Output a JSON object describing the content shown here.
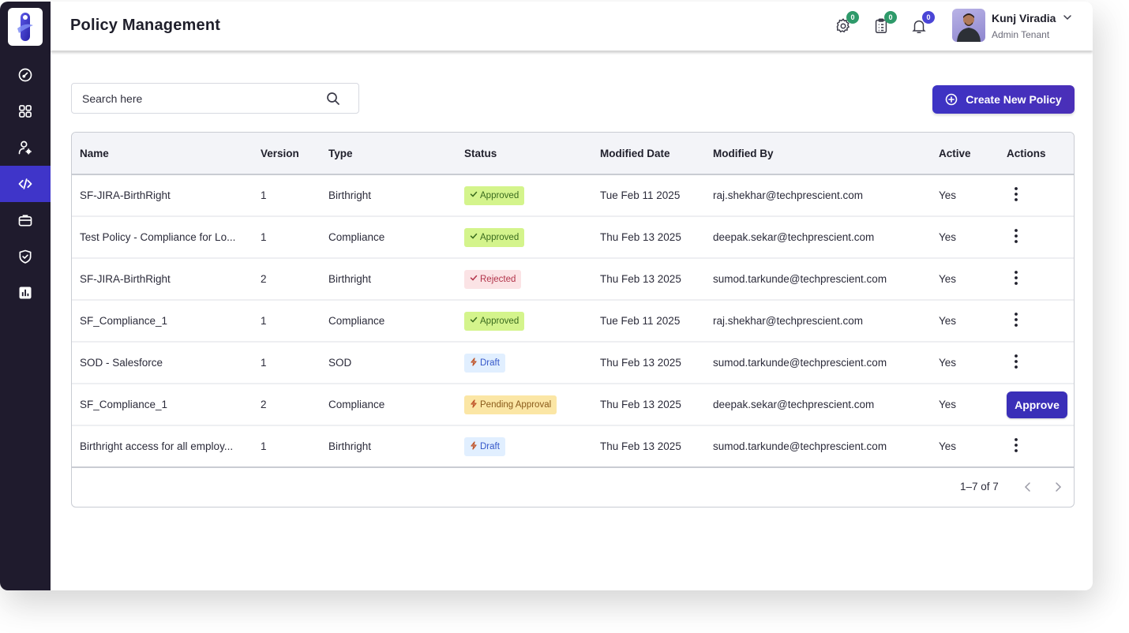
{
  "app": {
    "page_title": "Policy Management"
  },
  "sidebar": {
    "items": [
      {
        "name": "dashboard",
        "icon": "gauge-icon",
        "active": false
      },
      {
        "name": "applications",
        "icon": "grid-icon",
        "active": false
      },
      {
        "name": "user-settings",
        "icon": "user-gear-icon",
        "active": false
      },
      {
        "name": "policies",
        "icon": "code-icon",
        "active": true
      },
      {
        "name": "workspace",
        "icon": "briefcase-icon",
        "active": false
      },
      {
        "name": "security",
        "icon": "shield-check-icon",
        "active": false
      },
      {
        "name": "reports",
        "icon": "bar-chart-icon",
        "active": false
      }
    ]
  },
  "header": {
    "settings_badge": "0",
    "tasks_badge": "0",
    "notifications_badge": "0",
    "user_name": "Kunj Viradia",
    "user_role": "Admin Tenant",
    "colors": {
      "settings_badge": "#2e9a6a",
      "tasks_badge": "#2e9a6a",
      "notifications_badge": "#4a45d6"
    }
  },
  "toolbar": {
    "search_placeholder": "Search here",
    "search_value": "",
    "create_label": "Create New Policy"
  },
  "table": {
    "columns": [
      "Name",
      "Version",
      "Type",
      "Status",
      "Modified Date",
      "Modified By",
      "Active",
      "Actions"
    ],
    "rows": [
      {
        "name": "SF-JIRA-BirthRight",
        "version": "1",
        "type": "Birthright",
        "status": "Approved",
        "status_kind": "approved",
        "modified_date": "Tue Feb 11 2025",
        "modified_by": "raj.shekhar@techprescient.com",
        "active": "Yes",
        "action": "menu"
      },
      {
        "name": "Test Policy - Compliance for Lo...",
        "version": "1",
        "type": "Compliance",
        "status": "Approved",
        "status_kind": "approved",
        "modified_date": "Thu Feb 13 2025",
        "modified_by": "deepak.sekar@techprescient.com",
        "active": "Yes",
        "action": "menu"
      },
      {
        "name": "SF-JIRA-BirthRight",
        "version": "2",
        "type": "Birthright",
        "status": "Rejected",
        "status_kind": "rejected",
        "modified_date": "Thu Feb 13 2025",
        "modified_by": "sumod.tarkunde@techprescient.com",
        "active": "Yes",
        "action": "menu"
      },
      {
        "name": "SF_Compliance_1",
        "version": "1",
        "type": "Compliance",
        "status": "Approved",
        "status_kind": "approved",
        "modified_date": "Tue Feb 11 2025",
        "modified_by": "raj.shekhar@techprescient.com",
        "active": "Yes",
        "action": "menu"
      },
      {
        "name": "SOD - Salesforce",
        "version": "1",
        "type": "SOD",
        "status": "Draft",
        "status_kind": "draft",
        "modified_date": "Thu Feb 13 2025",
        "modified_by": "sumod.tarkunde@techprescient.com",
        "active": "Yes",
        "action": "menu"
      },
      {
        "name": "SF_Compliance_1",
        "version": "2",
        "type": "Compliance",
        "status": "Pending Approval",
        "status_kind": "pending",
        "modified_date": "Thu Feb 13 2025",
        "modified_by": "deepak.sekar@techprescient.com",
        "active": "Yes",
        "action": "approve",
        "action_label": "Approve"
      },
      {
        "name": "Birthright access for all employ...",
        "version": "1",
        "type": "Birthright",
        "status": "Draft",
        "status_kind": "draft",
        "modified_date": "Thu Feb 13 2025",
        "modified_by": "sumod.tarkunde@techprescient.com",
        "active": "Yes",
        "action": "menu"
      }
    ]
  },
  "pagination": {
    "range_text": "1–7 of 7"
  },
  "colors": {
    "sidebar_bg": "#1f1b2d",
    "accent": "#3f35c9",
    "approved_bg": "#d4f48c",
    "rejected_bg": "#fbe3e5",
    "draft_bg": "#e1efff",
    "pending_bg": "#fbe6a5"
  }
}
